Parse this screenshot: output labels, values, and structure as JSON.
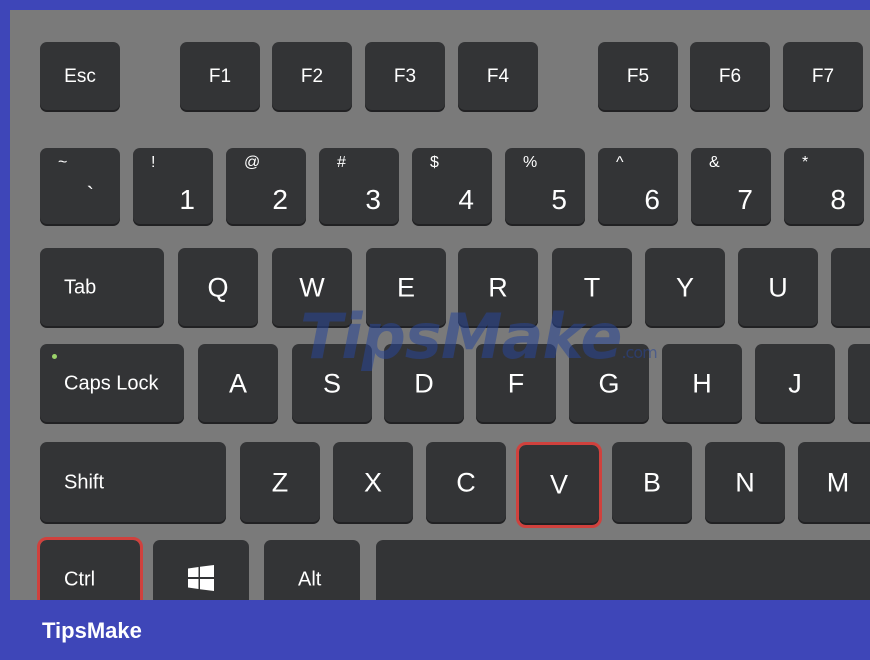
{
  "keyboard": {
    "row_fn": [
      "Esc",
      "F1",
      "F2",
      "F3",
      "F4",
      "F5",
      "F6",
      "F7"
    ],
    "row_num": [
      {
        "top": "~",
        "main": "`"
      },
      {
        "top": "!",
        "main": "1"
      },
      {
        "top": "@",
        "main": "2"
      },
      {
        "top": "#",
        "main": "3"
      },
      {
        "top": "$",
        "main": "4"
      },
      {
        "top": "%",
        "main": "5"
      },
      {
        "top": "^",
        "main": "6"
      },
      {
        "top": "&",
        "main": "7"
      },
      {
        "top": "*",
        "main": "8"
      }
    ],
    "row_q": [
      "Tab",
      "Q",
      "W",
      "E",
      "R",
      "T",
      "Y",
      "U"
    ],
    "row_a": [
      "Caps Lock",
      "A",
      "S",
      "D",
      "F",
      "G",
      "H",
      "J"
    ],
    "row_z": [
      "Shift",
      "Z",
      "X",
      "C",
      "V",
      "B",
      "N",
      "M"
    ],
    "row_bottom": [
      "Ctrl",
      "",
      "Alt"
    ],
    "highlighted_keys": [
      "V",
      "Ctrl"
    ],
    "highlight_color": "#d0413d",
    "key_color": "#333436",
    "board_color": "#7a7a7a",
    "windows_key_icon": "windows-logo-icon"
  },
  "watermark": {
    "text": "TipsMake",
    "suffix": ".com"
  },
  "brand_bar": {
    "text": "TipsMake",
    "color": "#3e46b8"
  }
}
